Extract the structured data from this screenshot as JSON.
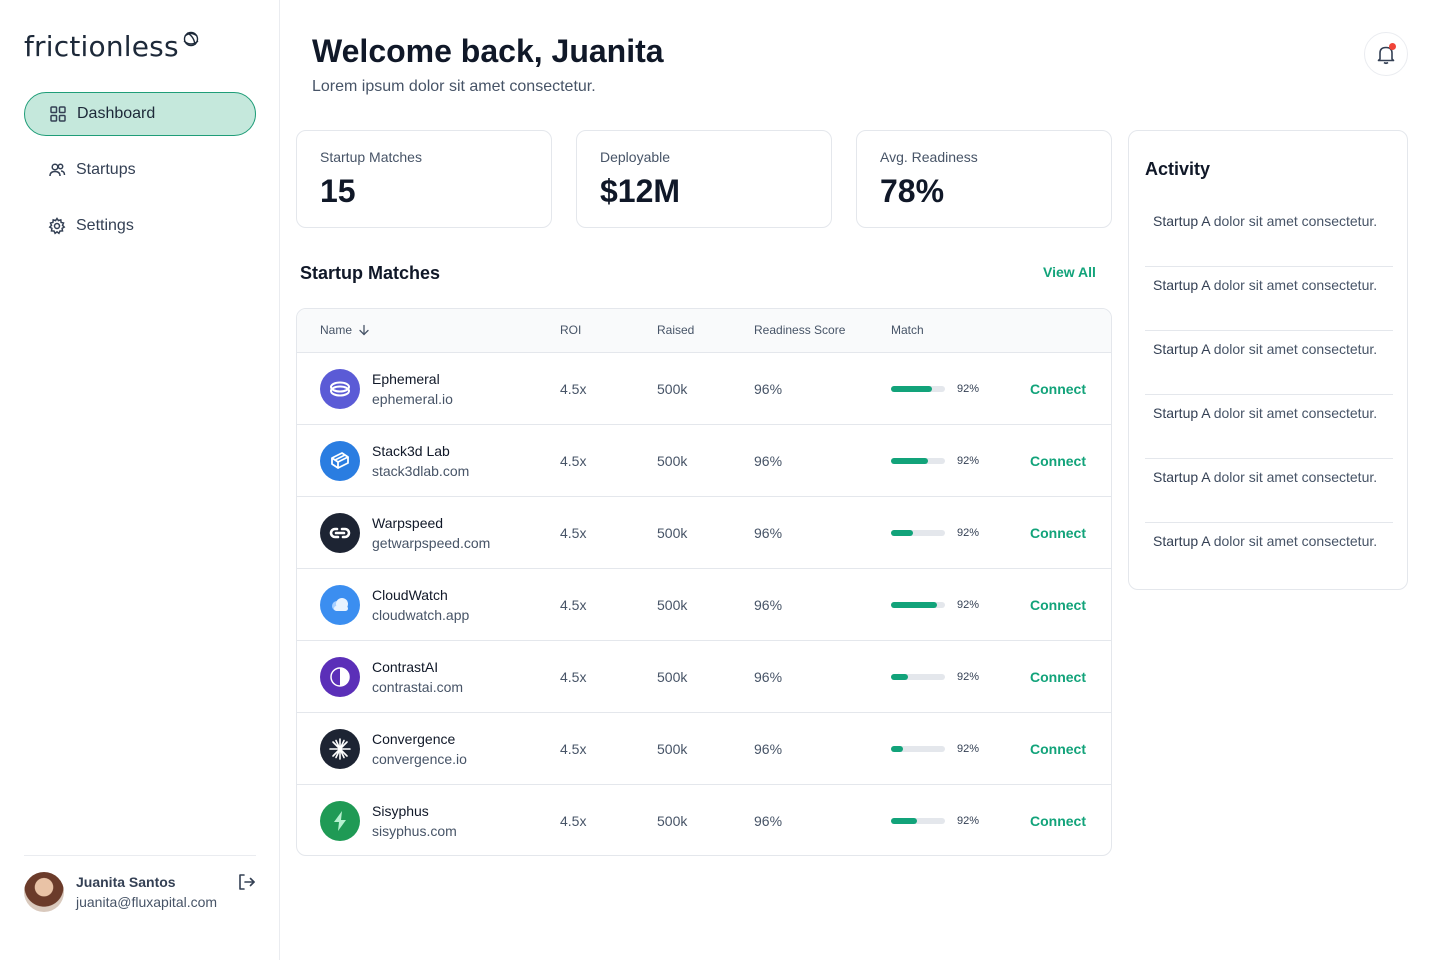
{
  "brand": {
    "name": "frictionless",
    "accent": "#12a37a"
  },
  "nav": {
    "items": [
      {
        "label": "Dashboard",
        "icon": "grid-icon",
        "active": true
      },
      {
        "label": "Startups",
        "icon": "users-icon",
        "active": false
      },
      {
        "label": "Settings",
        "icon": "gear-icon",
        "active": false
      }
    ]
  },
  "user": {
    "name": "Juanita Santos",
    "email": "juanita@fluxapital.com"
  },
  "header": {
    "title": "Welcome back, Juanita",
    "subtitle": "Lorem ipsum dolor sit amet consectetur."
  },
  "stats": [
    {
      "label": "Startup Matches",
      "value": "15"
    },
    {
      "label": "Deployable",
      "value": "$12M"
    },
    {
      "label": "Avg. Readiness",
      "value": "78%"
    }
  ],
  "matches": {
    "title": "Startup Matches",
    "view_all": "View All",
    "columns": {
      "name": "Name",
      "roi": "ROI",
      "raised": "Raised",
      "readiness": "Readiness Score",
      "match": "Match"
    },
    "connect_label": "Connect",
    "rows": [
      {
        "name": "Ephemeral",
        "url": "ephemeral.io",
        "roi": "4.5x",
        "raised": "500k",
        "readiness": "96%",
        "match": "92%",
        "match_fill": 0.75,
        "logo_color": "#5b5bd6",
        "logo_icon": "rings-icon"
      },
      {
        "name": "Stack3d Lab",
        "url": "stack3dlab.com",
        "roi": "4.5x",
        "raised": "500k",
        "readiness": "96%",
        "match": "92%",
        "match_fill": 0.68,
        "logo_color": "#2a7de1",
        "logo_icon": "stack-icon"
      },
      {
        "name": "Warpspeed",
        "url": "getwarpspeed.com",
        "roi": "4.5x",
        "raised": "500k",
        "readiness": "96%",
        "match": "92%",
        "match_fill": 0.4,
        "logo_color": "#1d2433",
        "logo_icon": "link-icon"
      },
      {
        "name": "CloudWatch",
        "url": "cloudwatch.app",
        "roi": "4.5x",
        "raised": "500k",
        "readiness": "96%",
        "match": "92%",
        "match_fill": 0.85,
        "logo_color": "#3b8ef0",
        "logo_icon": "cloud-icon"
      },
      {
        "name": "ContrastAI",
        "url": "contrastai.com",
        "roi": "4.5x",
        "raised": "500k",
        "readiness": "96%",
        "match": "92%",
        "match_fill": 0.32,
        "logo_color": "#5b2fb8",
        "logo_icon": "half-circle-icon"
      },
      {
        "name": "Convergence",
        "url": "convergence.io",
        "roi": "4.5x",
        "raised": "500k",
        "readiness": "96%",
        "match": "92%",
        "match_fill": 0.22,
        "logo_color": "#1d2433",
        "logo_icon": "spark-icon"
      },
      {
        "name": "Sisyphus",
        "url": "sisyphus.com",
        "roi": "4.5x",
        "raised": "500k",
        "readiness": "96%",
        "match": "92%",
        "match_fill": 0.48,
        "logo_color": "#1f9a55",
        "logo_icon": "bolt-icon"
      }
    ]
  },
  "activity": {
    "title": "Activity",
    "items": [
      {
        "subject": "Startup A",
        "text": " dolor sit amet consectetur."
      },
      {
        "subject": "Startup A",
        "text": " dolor sit amet consectetur."
      },
      {
        "subject": "Startup A",
        "text": " dolor sit amet consectetur."
      },
      {
        "subject": "Startup A",
        "text": " dolor sit amet consectetur."
      },
      {
        "subject": "Startup A",
        "text": " dolor sit amet consectetur."
      },
      {
        "subject": "Startup A",
        "text": " dolor sit amet consectetur."
      }
    ]
  }
}
